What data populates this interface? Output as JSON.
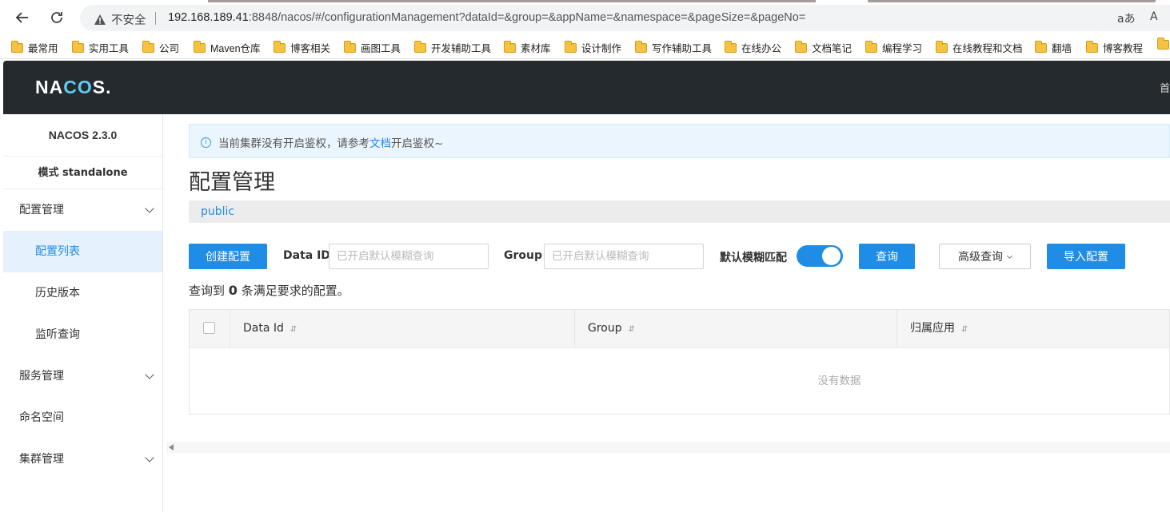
{
  "browser": {
    "insecure_label": "不安全",
    "url_host": "192.168.189.41",
    "url_rest": ":8848/nacos/#/configurationManagement?dataId=&group=&appName=&namespace=&pageSize=&pageNo=",
    "right_icon_1": "aあ",
    "right_icon_2": "A",
    "bookmarks": [
      "最常用",
      "实用工具",
      "公司",
      "Maven仓库",
      "博客相关",
      "画图工具",
      "开发辅助工具",
      "素材库",
      "设计制作",
      "写作辅助工具",
      "在线办公",
      "文档笔记",
      "编程学习",
      "在线教程和文档",
      "翻墙",
      "博客教程"
    ]
  },
  "header": {
    "logo_pre": "NA",
    "logo_cc": "CO",
    "logo_post": "S.",
    "right_text": "首"
  },
  "sidebar": {
    "version": "NACOS 2.3.0",
    "mode": "模式 standalone",
    "group_config": "配置管理",
    "item_config_list": "配置列表",
    "item_history": "历史版本",
    "item_listen": "监听查询",
    "group_service": "服务管理",
    "group_namespace": "命名空间",
    "group_cluster": "集群管理"
  },
  "main": {
    "notice_pre": "当前集群没有开启鉴权，请参考",
    "notice_link": "文档",
    "notice_post": "开启鉴权~",
    "title": "配置管理",
    "namespace": "public",
    "create_btn": "创建配置",
    "dataid_label": "Data ID",
    "dataid_placeholder": "已开启默认模糊查询",
    "group_label": "Group",
    "group_placeholder": "已开启默认模糊查询",
    "fuzzy_label": "默认模糊匹配",
    "query_btn": "查询",
    "advanced_btn": "高级查询",
    "import_btn": "导入配置",
    "result_pre": "查询到",
    "result_count": "0",
    "result_post": "条满足要求的配置。",
    "columns": [
      "Data Id",
      "Group",
      "归属应用"
    ],
    "sort_icon": "⇵",
    "empty": "没有数据"
  }
}
